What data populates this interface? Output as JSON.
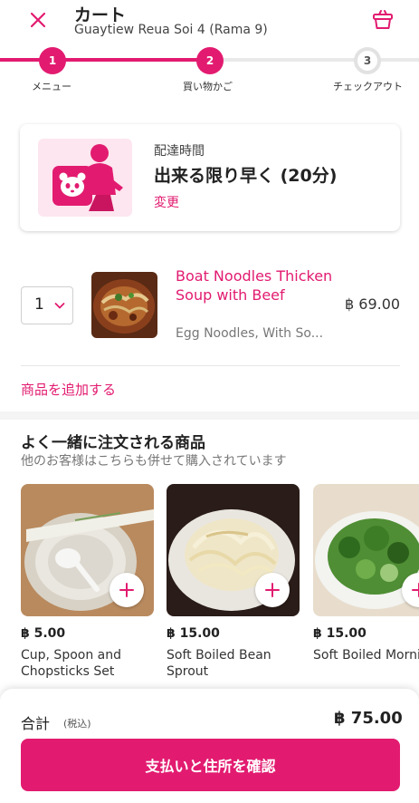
{
  "header": {
    "title": "カート",
    "subtitle": "Guaytiew Reua Soi 4 (Rama 9)"
  },
  "stepper": {
    "steps": [
      {
        "number": "1",
        "label": "メニュー"
      },
      {
        "number": "2",
        "label": "買い物かご"
      },
      {
        "number": "3",
        "label": "チェックアウト"
      }
    ]
  },
  "delivery": {
    "label": "配達時間",
    "value": "出来る限り早く (20分)",
    "change": "変更"
  },
  "cart_item": {
    "quantity": "1",
    "name": "Boat Noodles Thicken Soup with Beef",
    "description": "Egg Noodles, With So...",
    "price": "฿ 69.00"
  },
  "add_items": "商品を追加する",
  "recommendations": {
    "title": "よく一緒に注文される商品",
    "subtitle": "他のお客様はこちらも併せて購入されています",
    "items": [
      {
        "price": "฿ 5.00",
        "name": "Cup, Spoon and Chopsticks Set"
      },
      {
        "price": "฿ 15.00",
        "name": "Soft Boiled Bean Sprout"
      },
      {
        "price": "฿ 15.00",
        "name": "Soft Boiled Morning Glory"
      }
    ]
  },
  "footer": {
    "total_label": "合計",
    "tax_label": "(税込)",
    "total_value": "฿ 75.00",
    "checkout_button": "支払いと住所を確認"
  },
  "colors": {
    "brand": "#e21b70",
    "text": "#222222",
    "muted": "#777777"
  },
  "icons": [
    "close-icon",
    "basket-icon",
    "chevron-down-icon",
    "plus-icon"
  ]
}
